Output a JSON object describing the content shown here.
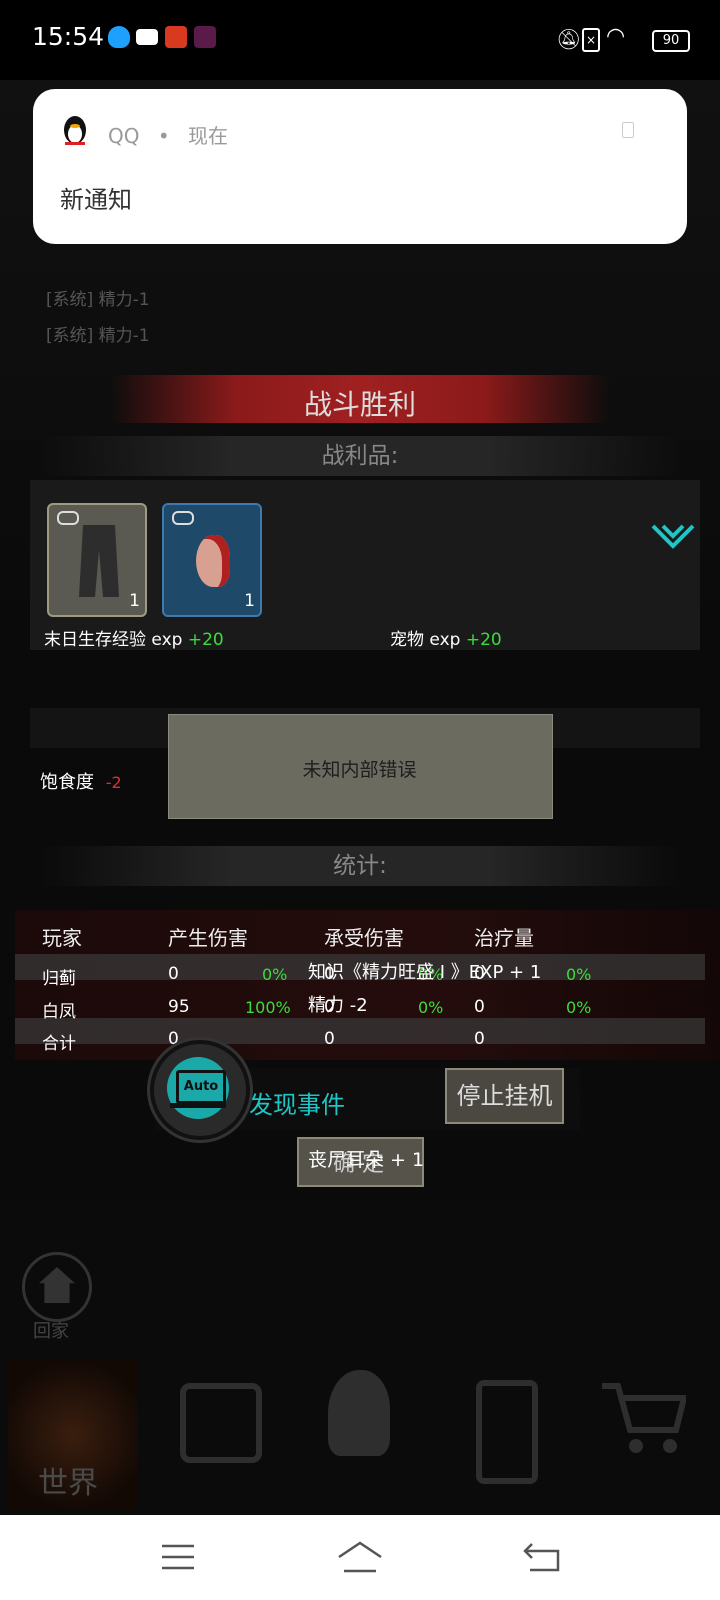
{
  "status_bar": {
    "time": "15:54",
    "battery": "90"
  },
  "notification": {
    "app": "QQ",
    "when": "现在",
    "title": "新通知"
  },
  "background_log": [
    "[系统] 精力-1",
    "[系统] 精力-1"
  ],
  "battle": {
    "title": "战斗胜利",
    "loot_header": "战利品:",
    "items": [
      {
        "name": "pants",
        "count": "1"
      },
      {
        "name": "ear",
        "count": "1"
      }
    ],
    "rewards": [
      {
        "label": "末日生存经验 exp",
        "value": "+20"
      },
      {
        "label": "宠物 exp",
        "value": "+20"
      }
    ],
    "hunger_label": "饱食度",
    "hunger_value": "-2",
    "error": "未知内部错误",
    "stats_header": "统计:",
    "stats": {
      "columns": [
        "玩家",
        "产生伤害",
        "承受伤害",
        "治疗量"
      ],
      "rows": [
        {
          "player": "归蓟",
          "dealt": "0",
          "dealt_pct": "0%",
          "taken": "0",
          "taken_pct": "0%",
          "heal": "0",
          "heal_pct": "0%"
        },
        {
          "player": "白凤",
          "dealt": "95",
          "dealt_pct": "100%",
          "taken": "0",
          "taken_pct": "0%",
          "heal": "0",
          "heal_pct": "0%"
        },
        {
          "player": "合计",
          "dealt": "0",
          "taken": "0",
          "heal": "0"
        }
      ]
    },
    "float_messages": [
      "知识《精力旺盛 I 》EXP + 1",
      "精力 -2",
      "丧尸耳朵 + 1"
    ],
    "confirm_label": "确 定"
  },
  "auto": {
    "icon_text": "Auto",
    "label": "发现事件",
    "stop_label": "停止挂机"
  },
  "home_label": "回家",
  "game_nav": {
    "world_label": "世界"
  }
}
